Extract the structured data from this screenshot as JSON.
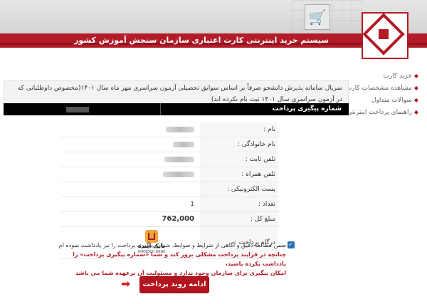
{
  "header": {
    "system_title": "سیستم خرید اینترنتی کارت اعتباری سازمان سنجش آموزش کشور"
  },
  "sidebar": {
    "items": [
      {
        "label": "خرید کارت"
      },
      {
        "label": "مشاهده مشخصات کارت"
      },
      {
        "label": "سوالات متداول"
      },
      {
        "label": "راهنمای پرداخت اینترنتی"
      }
    ]
  },
  "main": {
    "notice_text": "سریال سامانه پذیرش دانشجو صرفاً بر اساس سوابق تحصیلی آزمون سراسری مهر ماه سال ۱۴۰۱(مخصوص داوطلبانی که در آزمون سراسری سال ۱۴۰۱ ثبت نام نکرده اند)",
    "tracking_label": "شماره پیگیری پرداخت"
  },
  "form": {
    "rows": [
      {
        "label": "نام :",
        "value": ""
      },
      {
        "label": "نام خانوادگی :",
        "value": ""
      },
      {
        "label": "تلفن ثابت :",
        "value": ""
      },
      {
        "label": "تلفن همراه :",
        "value": ""
      },
      {
        "label": "پست الکترونیکی :",
        "value": ""
      },
      {
        "label": "تعداد :",
        "value": "1"
      },
      {
        "label": "مبلغ کل :",
        "value": "762,000"
      },
      {
        "label": "درگاه پرداخت :",
        "value": ""
      }
    ],
    "bank_name": "بانک آینده",
    "bank_sub": "AYANDEH BANK"
  },
  "agreement": {
    "line1": "ضمن مطالعه دقیق و آگاهی از شرایط و ضوابط، شماره پیگیری پرداخت را نیز یادداشت نموده ام",
    "line2": "چنانچه در فرایند پرداخت مشکلی بروز کند و شما «شماره پیگیری پرداخت» را یادداشت نکرده باشید،",
    "line3": "امکان پیگیری برای سازمان وجود ندارد و مسئولیت آن برعهده شما می باشد"
  },
  "actions": {
    "continue_label": "ادامه روند پرداخت"
  },
  "colors": {
    "brand_red": "#b31b27"
  }
}
